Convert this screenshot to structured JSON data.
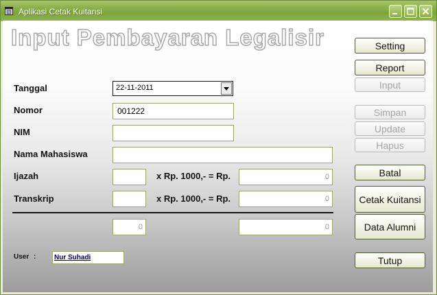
{
  "window": {
    "title": "Aplikasi Cetak Kuitansi"
  },
  "heading": "Input Pembayaran Legalisir",
  "form": {
    "tanggal_label": "Tanggal",
    "tanggal_value": "22-11-2011",
    "nomor_label": "Nomor",
    "nomor_value": "001222",
    "nim_label": "NIM",
    "nim_value": "",
    "nama_label": "Nama Mahasiswa",
    "nama_value": "",
    "ijazah_label": "Ijazah",
    "ijazah_qty": "",
    "ijazah_total": "0",
    "transkrip_label": "Transkrip",
    "transkrip_qty": "",
    "transkrip_total": "0",
    "rate_text": "x Rp. 1000,- = Rp.",
    "sum_qty": "0",
    "sum_total": "0"
  },
  "user": {
    "label": "User",
    "colon": ":",
    "value": "Nur Suhadi"
  },
  "buttons": {
    "setting": "Setting",
    "report": "Report",
    "input": "Input",
    "simpan": "Simpan",
    "update": "Update",
    "hapus": "Hapus",
    "batal": "Batal",
    "cetak": "Cetak Kuitansi",
    "alumni": "Data Alumni",
    "tutup": "Tutup"
  },
  "icons": {
    "app": "app-window-icon",
    "minimize": "minimize-icon",
    "maximize": "maximize-icon",
    "close": "close-icon",
    "dropdown": "chevron-down-icon"
  }
}
